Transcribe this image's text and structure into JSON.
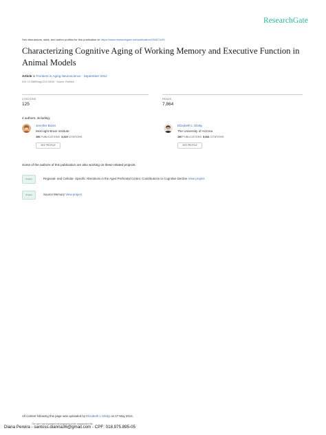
{
  "brand": {
    "logo_text": "ResearchGate"
  },
  "header": {
    "discussion_text": "See discussions, stats, and author profiles for this publication at: ",
    "publication_url": "https://www.researchgate.net/publication/230871190"
  },
  "paper": {
    "title": "Characterizing Cognitive Aging of Working Memory and Executive Function in Animal Models",
    "type": "Article",
    "in_word": "in",
    "journal": "Frontiers in Aging Neuroscience · September 2012",
    "doi_line": "DOI: 10.3389/fnagi.2012.00019 · Source: PubMed"
  },
  "stats": {
    "citations_label": "CITATIONS",
    "citations_value": "125",
    "reads_label": "READS",
    "reads_value": "7,864"
  },
  "authors": {
    "heading": "4 authors, including:",
    "list": [
      {
        "name": "Jennifer Bizon",
        "institution": "McKnight Brain Institute",
        "publications": "106",
        "publications_label": "PUBLICATIONS",
        "citations": "3,319",
        "citations_label": "CITATIONS",
        "button": "SEE PROFILE"
      },
      {
        "name": "Elizabeth L Glisky",
        "institution": "The University of Arizona",
        "publications": "100",
        "publications_label": "PUBLICATIONS",
        "citations": "5,341",
        "citations_label": "CITATIONS",
        "button": "SEE PROFILE"
      }
    ]
  },
  "projects": {
    "heading": "Some of the authors of this publication are also working on these related projects:",
    "badge": "Project",
    "view_link": "View project",
    "items": [
      {
        "text": "Regional- and Cellular- Specific Alterations in the Aged Prefrontal Cortex: Contributions to Cognitive Decline"
      },
      {
        "text": "Source Memory"
      }
    ]
  },
  "footer": {
    "uploaded_prefix": "All content following this page was uploaded by ",
    "uploaded_by": "Elizabeth L Glisky",
    "uploaded_suffix": " on 27 May 2014.",
    "footnote": "The user has requested enhancement of the downloaded file.",
    "watermark": "Diana Pereira - santoss.dianna36@gmail.com - CPF: 018.975.895-05"
  },
  "colors": {
    "brand_teal": "#2bb5a0",
    "link_blue": "#3b6fb6"
  }
}
